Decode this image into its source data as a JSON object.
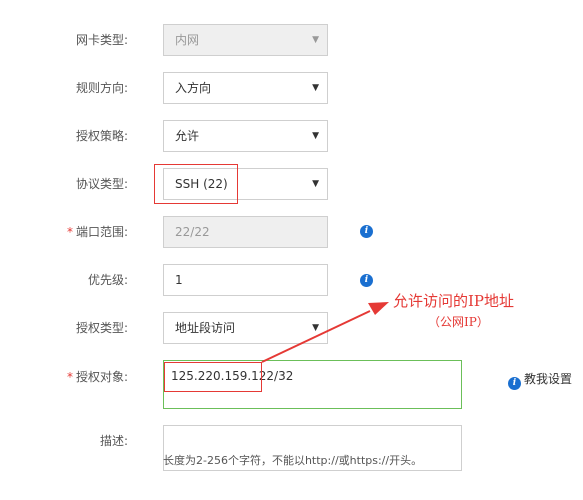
{
  "form": {
    "nic_type": {
      "label": "网卡类型:",
      "value": "内网"
    },
    "direction": {
      "label": "规则方向:",
      "value": "入方向"
    },
    "policy": {
      "label": "授权策略:",
      "value": "允许"
    },
    "protocol": {
      "label": "协议类型:",
      "value": "SSH (22)"
    },
    "port_range": {
      "required": "*",
      "label": "端口范围:",
      "value": "22/22"
    },
    "priority": {
      "label": "优先级:",
      "value": "1"
    },
    "auth_type": {
      "label": "授权类型:",
      "value": "地址段访问"
    },
    "auth_object": {
      "required": "*",
      "label": "授权对象:",
      "value": "125.220.159.122/32"
    },
    "description": {
      "label": "描述:",
      "hint": "长度为2-256个字符，不能以http://或https://开头。"
    }
  },
  "help": {
    "icon_glyph": "i",
    "text": "教我设置"
  },
  "annotation": {
    "line1": "允许访问的IP地址",
    "line2": "（公网IP）"
  },
  "icons": {
    "caret": "▼",
    "info": "i"
  },
  "colors": {
    "annotation": "#e53935",
    "info": "#1a6fd0",
    "valid_border": "#6bbf59"
  }
}
